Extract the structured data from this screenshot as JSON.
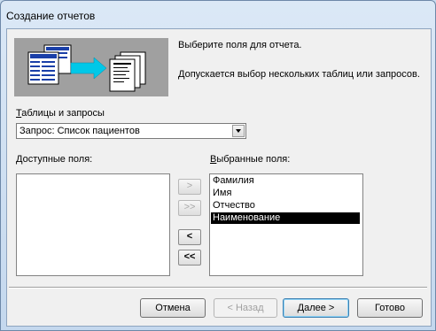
{
  "window": {
    "title": "Создание отчетов"
  },
  "info": {
    "line1": "Выберите поля для отчета.",
    "line2": "Допускается выбор нескольких таблиц или запросов."
  },
  "tables_label_u": "Т",
  "tables_label_rest": "аблицы и запросы",
  "source_combo": {
    "value": "Запрос: Список пациентов"
  },
  "available": {
    "label_u": "Д",
    "label_rest": "оступные поля:",
    "items": []
  },
  "selected": {
    "label_u": "В",
    "label_rest": "ыбранные поля:",
    "items": [
      "Фамилия",
      "Имя",
      "Отчество",
      "Наименование"
    ],
    "selected_index": 3
  },
  "move_buttons": {
    "add_one": ">",
    "add_all": ">>",
    "remove_one": "<",
    "remove_all": "<<"
  },
  "footer": {
    "cancel": "Отмена",
    "back": "< Назад",
    "next": "Далее >",
    "finish": "Готово"
  },
  "colors": {
    "title_bg": "#c4d8ee",
    "selection": "#000000",
    "illustration_bg": "#a0a0a0",
    "arrow": "#00c8e8"
  }
}
